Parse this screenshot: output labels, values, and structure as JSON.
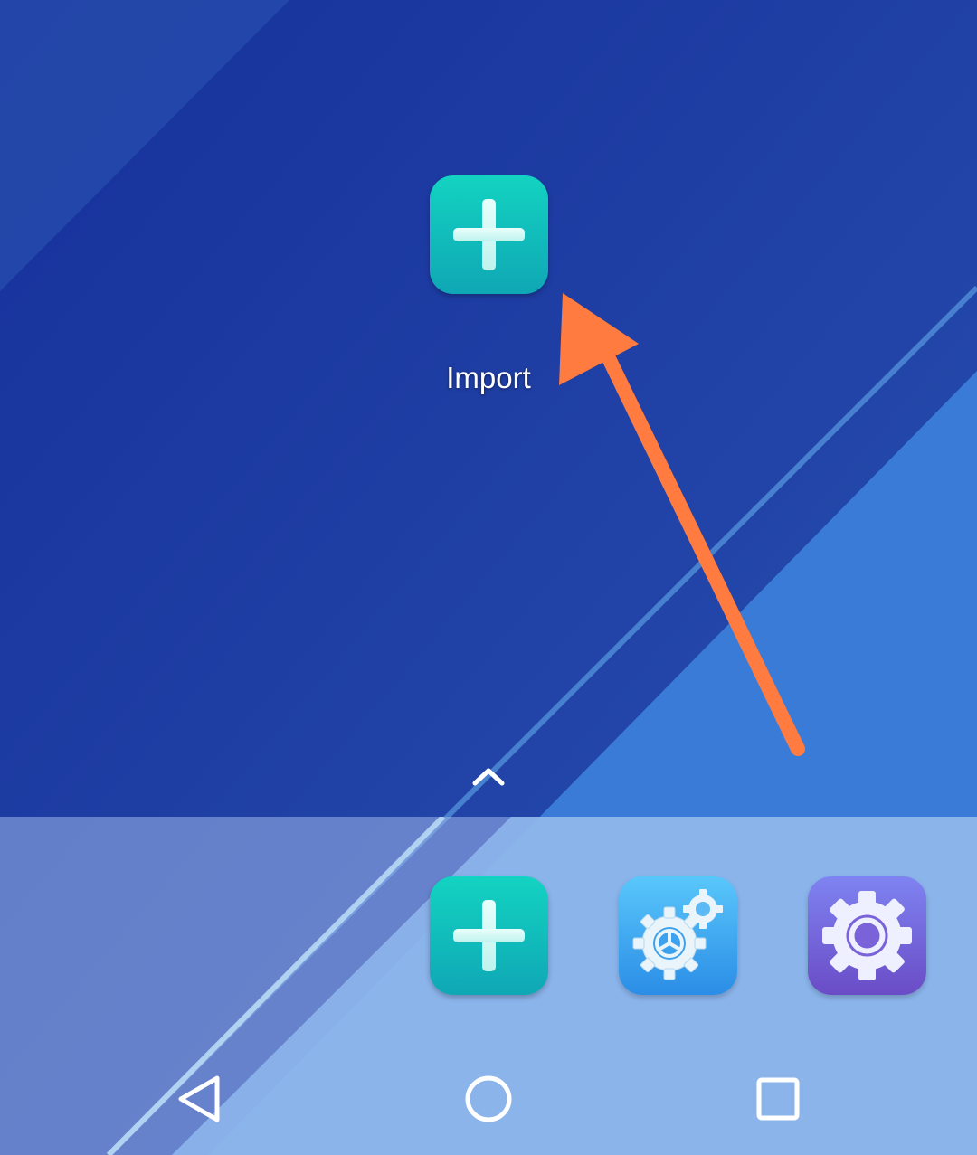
{
  "home": {
    "app": {
      "label": "Import",
      "icon": "plus-icon"
    }
  },
  "drawer": {
    "icon": "chevron-up-icon"
  },
  "dock": {
    "apps": [
      {
        "icon": "plus-icon",
        "color": "#13c6bd"
      },
      {
        "icon": "gear-steering-icon",
        "color": "#3fa6f1"
      },
      {
        "icon": "settings-gear-icon",
        "color": "#7560d6"
      }
    ]
  },
  "annotation": {
    "icon": "arrow-icon",
    "color": "#ff7b3f"
  },
  "navigation": {
    "back": "back-icon",
    "home": "home-icon",
    "recents": "recents-icon"
  }
}
